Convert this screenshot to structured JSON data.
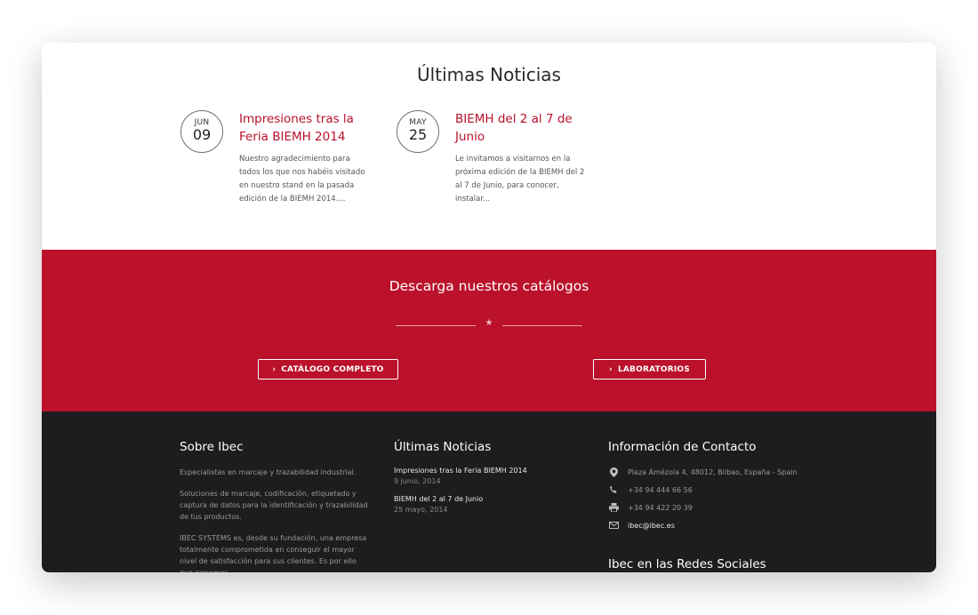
{
  "news_section": {
    "title": "Últimas Noticias",
    "posts": [
      {
        "month": "JUN",
        "day": "09",
        "title": "Impresiones tras la Feria BIEMH 2014",
        "excerpt": "Nuestro agradecimiento para todos los que nos habéis visitado en nuestro stand en la pasada edición de la BIEMH 2014...."
      },
      {
        "month": "MAY",
        "day": "25",
        "title": "BIEMH del 2 al 7 de Junio",
        "excerpt": "Le invitamos a visitarnos en la próxima edición de la BIEMH del 2 al 7 de Junio, para conocer, instalar..."
      }
    ]
  },
  "catalog_section": {
    "title": "Descarga nuestros catálogos",
    "buttons": {
      "complete": "CATÁLOGO COMPLETO",
      "labs": "LABORATORIOS"
    },
    "colors": {
      "background": "#bb112a"
    }
  },
  "footer": {
    "about": {
      "title": "Sobre Ibec",
      "paragraphs": [
        "Especialistas en marcaje y trazabilidad industrial.",
        "Soluciones de marcaje, codificación, etiquetado y captura de datos para la identificación y trazabilidad de tus productos.",
        "IBEC SYSTEMS es, desde su fundación, una empresa totalmente comprometida en conseguir el mayor nivel de satisfacción para sus clientes. Es por ello que ponemos"
      ]
    },
    "news": {
      "title": "Últimas Noticias",
      "items": [
        {
          "title": "Impresiones tras la Feria BIEMH 2014",
          "date": "9 junio, 2014"
        },
        {
          "title": "BIEMH del 2 al 7 de Junio",
          "date": "25 mayo, 2014"
        }
      ]
    },
    "contact": {
      "title": "Información de Contacto",
      "address": "Plaza Amézola 4, 48012, Bilbao, España - Spain",
      "phone": "+34 94 444 66 56",
      "fax": "+34 94 422 20 39",
      "email": "ibec@ibec.es",
      "social_title": "Ibec en las Redes Sociales"
    }
  },
  "icons": {
    "address": "map-marker-icon",
    "phone": "phone-icon",
    "fax": "printer-icon",
    "email": "envelope-icon"
  }
}
